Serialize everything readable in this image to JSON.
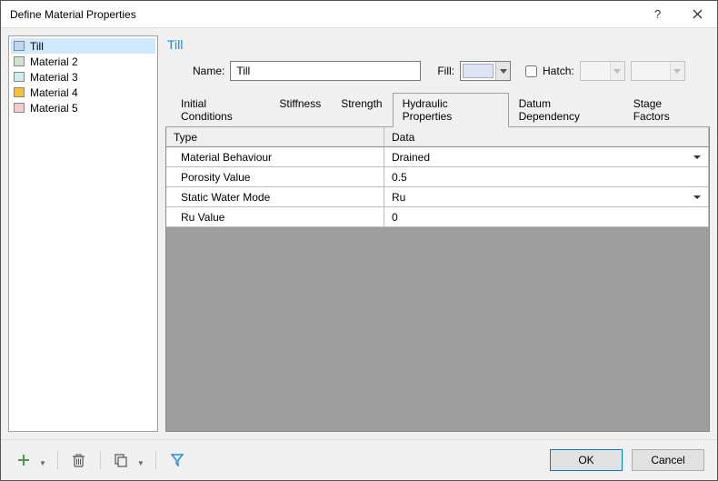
{
  "window": {
    "title": "Define Material Properties"
  },
  "materials": [
    {
      "name": "Till",
      "color": "#bcd8ef",
      "selected": true
    },
    {
      "name": "Material 2",
      "color": "#cfe3cf",
      "selected": false
    },
    {
      "name": "Material 3",
      "color": "#cdeeee",
      "selected": false
    },
    {
      "name": "Material 4",
      "color": "#f4c03c",
      "selected": false
    },
    {
      "name": "Material 5",
      "color": "#f6c9cc",
      "selected": false
    }
  ],
  "header": {
    "current_material": "Till",
    "name_label": "Name:",
    "name_value": "Till",
    "fill_label": "Fill:",
    "fill_color": "#dce4f5",
    "hatch_label": "Hatch:",
    "hatch_checked": false
  },
  "tabs": {
    "items": [
      {
        "label": "Initial Conditions",
        "active": false
      },
      {
        "label": "Stiffness",
        "active": false
      },
      {
        "label": "Strength",
        "active": false
      },
      {
        "label": "Hydraulic Properties",
        "active": true
      },
      {
        "label": "Datum Dependency",
        "active": false
      },
      {
        "label": "Stage Factors",
        "active": false
      }
    ]
  },
  "grid": {
    "col_type": "Type",
    "col_data": "Data",
    "rows": [
      {
        "type": "Material Behaviour",
        "data": "Drained",
        "dropdown": true
      },
      {
        "type": "Porosity Value",
        "data": "0.5",
        "dropdown": false
      },
      {
        "type": "Static Water Mode",
        "data": "Ru",
        "dropdown": true
      },
      {
        "type": "Ru Value",
        "data": "0",
        "dropdown": false
      }
    ]
  },
  "footer": {
    "ok": "OK",
    "cancel": "Cancel"
  }
}
